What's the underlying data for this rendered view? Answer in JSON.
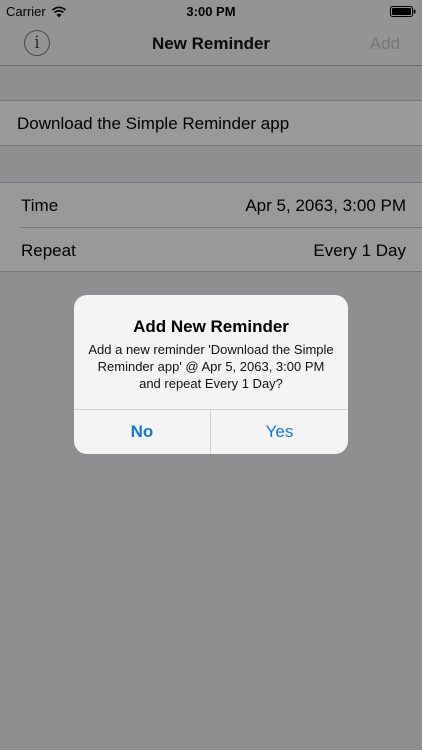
{
  "status_bar": {
    "carrier": "Carrier",
    "time": "3:00 PM",
    "icons": [
      "wifi-icon",
      "battery-icon"
    ]
  },
  "nav": {
    "info_icon": "i",
    "title": "New Reminder",
    "add_label": "Add"
  },
  "reminder": {
    "text": "Download the Simple Reminder app"
  },
  "settings": [
    {
      "label": "Time",
      "value": "Apr 5, 2063, 3:00 PM"
    },
    {
      "label": "Repeat",
      "value": "Every 1 Day"
    }
  ],
  "alert": {
    "title": "Add New Reminder",
    "message": "Add a new reminder 'Download the Simple Reminder app' @ Apr 5, 2063, 3:00 PM and repeat Every 1 Day?",
    "no_label": "No",
    "yes_label": "Yes"
  },
  "colors": {
    "accent": "#1778d9",
    "disabled": "#c4c4c4",
    "background": "#efeff4"
  }
}
